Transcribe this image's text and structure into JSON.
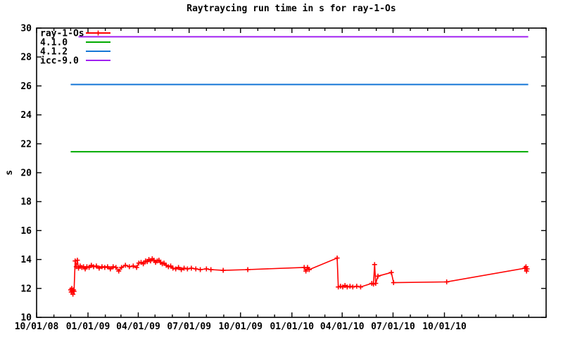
{
  "title": "Raytraycing run time in s for ray-1-Os",
  "colors": {
    "background": "#ffffff",
    "axis": "#000000",
    "ray_1_Os": "#ff0000",
    "v410": "#00aa00",
    "v412": "#1476d6",
    "icc90": "#a020f0"
  },
  "chart_data": {
    "type": "line",
    "title": "Raytraycing run time in s for ray-1-Os",
    "xlabel": "",
    "ylabel": "s",
    "ylim": [
      10,
      30
    ],
    "y_ticks": [
      10,
      12,
      14,
      16,
      18,
      20,
      22,
      24,
      26,
      28,
      30
    ],
    "xlim": [
      "2008-10-01",
      "2011-04-01"
    ],
    "xtick_labels": [
      "10/01/08",
      "01/01/09",
      "04/01/09",
      "07/01/09",
      "10/01/09",
      "01/01/10",
      "04/01/10",
      "07/01/10",
      "10/01/10"
    ],
    "minor_xtick_unit": "month",
    "grid": false,
    "legend_position": "top-left",
    "legend": [
      "ray-1-Os",
      "4.1.0",
      "4.1.2",
      "icc-9.0"
    ],
    "series": [
      {
        "name": "ray-1-Os",
        "type": "linespoints",
        "marker": "plus",
        "color": "#ff0000",
        "points": [
          [
            "2008-12-01",
            11.9
          ],
          [
            "2008-12-02",
            11.75
          ],
          [
            "2008-12-03",
            12.0
          ],
          [
            "2008-12-04",
            11.85
          ],
          [
            "2008-12-05",
            11.6
          ],
          [
            "2008-12-06",
            11.9
          ],
          [
            "2008-12-07",
            11.8
          ],
          [
            "2008-12-09",
            13.9
          ],
          [
            "2008-12-11",
            13.5
          ],
          [
            "2008-12-13",
            13.95
          ],
          [
            "2008-12-15",
            13.4
          ],
          [
            "2008-12-18",
            13.55
          ],
          [
            "2008-12-21",
            13.45
          ],
          [
            "2008-12-24",
            13.5
          ],
          [
            "2008-12-27",
            13.35
          ],
          [
            "2008-12-30",
            13.5
          ],
          [
            "2009-01-03",
            13.45
          ],
          [
            "2009-01-07",
            13.6
          ],
          [
            "2009-01-11",
            13.5
          ],
          [
            "2009-01-16",
            13.55
          ],
          [
            "2009-01-21",
            13.4
          ],
          [
            "2009-01-26",
            13.5
          ],
          [
            "2009-01-31",
            13.45
          ],
          [
            "2009-02-05",
            13.5
          ],
          [
            "2009-02-10",
            13.35
          ],
          [
            "2009-02-15",
            13.5
          ],
          [
            "2009-02-20",
            13.45
          ],
          [
            "2009-02-25",
            13.2
          ],
          [
            "2009-03-02",
            13.45
          ],
          [
            "2009-03-09",
            13.6
          ],
          [
            "2009-03-16",
            13.5
          ],
          [
            "2009-03-23",
            13.55
          ],
          [
            "2009-03-29",
            13.45
          ],
          [
            "2009-04-02",
            13.75
          ],
          [
            "2009-04-06",
            13.8
          ],
          [
            "2009-04-10",
            13.7
          ],
          [
            "2009-04-14",
            13.9
          ],
          [
            "2009-04-17",
            13.85
          ],
          [
            "2009-04-20",
            14.0
          ],
          [
            "2009-04-23",
            13.9
          ],
          [
            "2009-04-26",
            14.05
          ],
          [
            "2009-04-29",
            13.95
          ],
          [
            "2009-05-02",
            13.8
          ],
          [
            "2009-05-05",
            13.9
          ],
          [
            "2009-05-08",
            13.95
          ],
          [
            "2009-05-11",
            13.8
          ],
          [
            "2009-05-14",
            13.7
          ],
          [
            "2009-05-17",
            13.75
          ],
          [
            "2009-05-21",
            13.6
          ],
          [
            "2009-05-25",
            13.5
          ],
          [
            "2009-05-29",
            13.55
          ],
          [
            "2009-06-02",
            13.4
          ],
          [
            "2009-06-07",
            13.35
          ],
          [
            "2009-06-12",
            13.45
          ],
          [
            "2009-06-17",
            13.3
          ],
          [
            "2009-06-22",
            13.4
          ],
          [
            "2009-06-28",
            13.35
          ],
          [
            "2009-07-05",
            13.4
          ],
          [
            "2009-07-13",
            13.35
          ],
          [
            "2009-07-21",
            13.3
          ],
          [
            "2009-08-01",
            13.35
          ],
          [
            "2009-08-09",
            13.3
          ],
          [
            "2009-08-31",
            13.25
          ],
          [
            "2009-10-14",
            13.3
          ],
          [
            "2010-01-23",
            13.45
          ],
          [
            "2010-01-26",
            13.2
          ],
          [
            "2010-01-29",
            13.45
          ],
          [
            "2010-02-01",
            13.3
          ],
          [
            "2010-03-23",
            14.1
          ],
          [
            "2010-03-25",
            12.1
          ],
          [
            "2010-03-29",
            12.15
          ],
          [
            "2010-04-02",
            12.1
          ],
          [
            "2010-04-06",
            12.2
          ],
          [
            "2010-04-10",
            12.1
          ],
          [
            "2010-04-15",
            12.15
          ],
          [
            "2010-04-20",
            12.1
          ],
          [
            "2010-04-27",
            12.15
          ],
          [
            "2010-05-04",
            12.1
          ],
          [
            "2010-05-24",
            12.35
          ],
          [
            "2010-05-27",
            12.3
          ],
          [
            "2010-05-29",
            13.65
          ],
          [
            "2010-05-31",
            12.35
          ],
          [
            "2010-06-04",
            12.85
          ],
          [
            "2010-06-28",
            13.1
          ],
          [
            "2010-07-02",
            12.4
          ],
          [
            "2010-10-05",
            12.45
          ],
          [
            "2011-02-22",
            13.4
          ],
          [
            "2011-02-24",
            13.5
          ],
          [
            "2011-02-25",
            13.2
          ],
          [
            "2011-02-26",
            13.35
          ]
        ]
      },
      {
        "name": "4.1.0",
        "type": "hline",
        "color": "#00aa00",
        "value": 21.45,
        "span": [
          "2008-12-01",
          "2011-02-28"
        ]
      },
      {
        "name": "4.1.2",
        "type": "hline",
        "color": "#1476d6",
        "value": 26.1,
        "span": [
          "2008-12-01",
          "2011-02-28"
        ]
      },
      {
        "name": "icc-9.0",
        "type": "hline",
        "color": "#a020f0",
        "value": 29.4,
        "span": [
          "2008-12-15",
          "2011-02-28"
        ]
      }
    ]
  }
}
